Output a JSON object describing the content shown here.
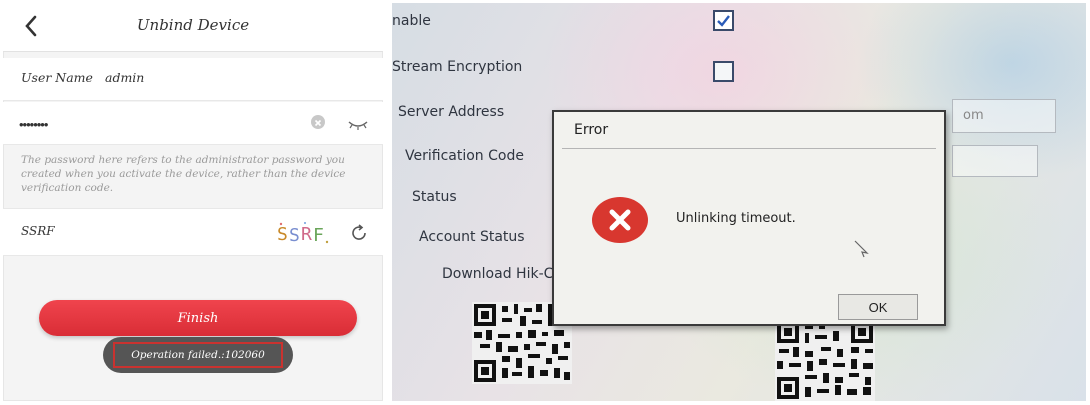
{
  "app": {
    "title": "Unbind Device",
    "username_label": "User Name",
    "username_value": "admin",
    "password_value": "••••••••",
    "password_hint": "The password here refers to the administrator password you created when you activate the device, rather than the device verification code.",
    "code_label": "SSRF",
    "captcha_text": "SSRF",
    "finish_label": "Finish",
    "toast_text": "Operation failed.:102060",
    "accent_color": "#e23b43",
    "icons": [
      "back-chevron-icon",
      "clear-icon",
      "eye-icon",
      "refresh-icon"
    ]
  },
  "device_screen": {
    "labels": {
      "enable": "nable",
      "stream_encryption": "Stream Encryption",
      "server_address": "Server Address",
      "verification_code": "Verification Code",
      "status": "Status",
      "account_status": "Account Status",
      "download": "Download Hik-Conne"
    },
    "enable_checked": true,
    "stream_encryption_checked": false,
    "server_address_value": "om",
    "dialog": {
      "title": "Error",
      "message": "Unlinking timeout.",
      "ok_label": "OK",
      "icon": "error-x-icon"
    }
  }
}
